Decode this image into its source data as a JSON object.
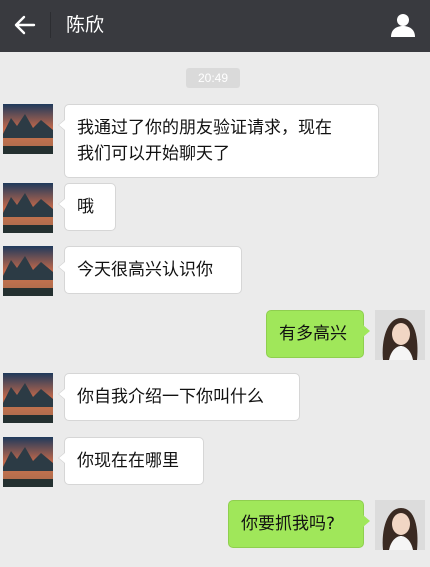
{
  "header": {
    "back_icon": "back-arrow-icon",
    "title": "陈欣",
    "profile_icon": "person-icon"
  },
  "chat": {
    "timestamp": "20:49",
    "messages": [
      {
        "side": "in",
        "text_line1": "我通过了你的朋友验证请求，现在",
        "text_line2": "我们可以开始聊天了"
      },
      {
        "side": "in",
        "text": "哦"
      },
      {
        "side": "in",
        "text": "今天很高兴认识你"
      },
      {
        "side": "out",
        "text": "有多高兴"
      },
      {
        "side": "in",
        "text": "你自我介绍一下你叫什么"
      },
      {
        "side": "in",
        "text": "你现在在哪里"
      },
      {
        "side": "out",
        "text": "你要抓我吗?"
      }
    ]
  },
  "colors": {
    "topbar": "#393a3f",
    "background": "#ebebeb",
    "bubble_in": "#ffffff",
    "bubble_out": "#a0e75a"
  }
}
